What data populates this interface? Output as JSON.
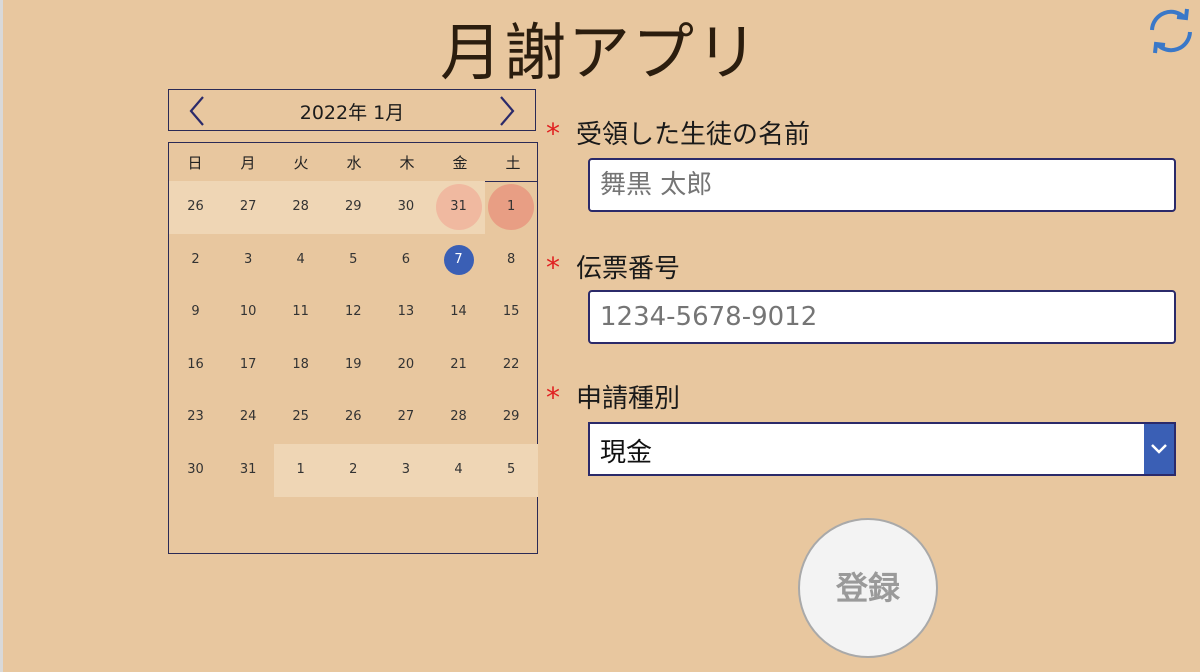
{
  "app": {
    "title": "月謝アプリ"
  },
  "icons": {
    "refresh": "refresh-icon",
    "prev": "chevron-left-icon",
    "next": "chevron-right-icon",
    "dropdown": "chevron-down-icon"
  },
  "colors": {
    "accent": "#3a5fb5",
    "background": "#e8c79f",
    "required": "#e02020",
    "border": "#2b2a55"
  },
  "calendar": {
    "month_label": "2022年 1月",
    "weekdays": [
      "日",
      "月",
      "火",
      "水",
      "木",
      "金",
      "土"
    ],
    "weeks": [
      [
        "26",
        "27",
        "28",
        "29",
        "30",
        "31",
        "1"
      ],
      [
        "2",
        "3",
        "4",
        "5",
        "6",
        "7",
        "8"
      ],
      [
        "9",
        "10",
        "11",
        "12",
        "13",
        "14",
        "15"
      ],
      [
        "16",
        "17",
        "18",
        "19",
        "20",
        "21",
        "22"
      ],
      [
        "23",
        "24",
        "25",
        "26",
        "27",
        "28",
        "29"
      ],
      [
        "30",
        "31",
        "1",
        "2",
        "3",
        "4",
        "5"
      ]
    ],
    "selected_day": "7"
  },
  "form": {
    "student_name": {
      "label": "受領した生徒の名前",
      "required_mark": "*",
      "placeholder": "舞黒 太郎"
    },
    "slip_number": {
      "label": "伝票番号",
      "required_mark": "*",
      "placeholder": "1234-5678-9012"
    },
    "payment_type": {
      "label": "申請種別",
      "required_mark": "*",
      "selected": "現金"
    },
    "submit_label": "登録"
  }
}
